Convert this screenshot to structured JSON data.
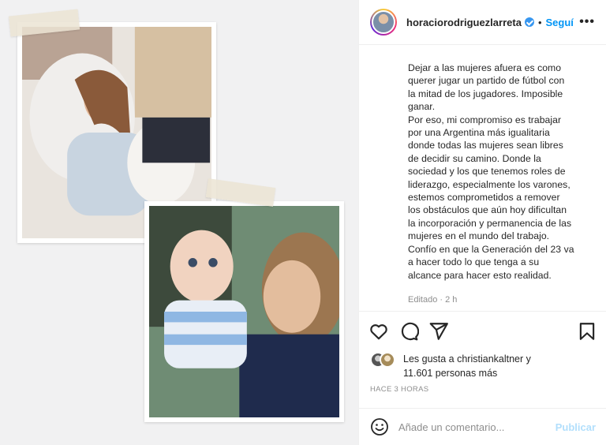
{
  "post": {
    "username": "horaciorodriguezlarreta",
    "follow_label": "Seguí",
    "more_label": "•••",
    "caption_lines": [
      "Dejar a las mujeres afuera es como",
      "querer jugar un partido de fútbol con",
      "la mitad de los jugadores. Imposible",
      "ganar.",
      "Por eso, mi compromiso es trabajar",
      "por una Argentina más igualitaria",
      "donde todas las mujeres sean libres",
      "de decidir su camino. Donde la",
      "sociedad y los que tenemos roles de",
      "liderazgo, especialmente los varones,",
      "estemos comprometidos a remover",
      "los obstáculos que aún hoy dificultan",
      "la incorporación y permanencia de las",
      "mujeres en el mundo del trabajo.",
      "Confío en que la Generación del 23 va",
      "a hacer todo lo que tenga a su",
      "alcance para hacer esto realidad."
    ],
    "edited_label": "Editado · 2 h",
    "likes_line1": "Les gusta a christiankaltner y",
    "likes_line2": "11.601 personas más",
    "timestamp": "HACE 3 HORAS",
    "comment_placeholder": "Añade un comentario...",
    "publish_label": "Publicar"
  },
  "icons": {
    "like": "heart-icon",
    "comment": "comment-icon",
    "share": "paper-plane-icon",
    "save": "bookmark-icon",
    "emoji": "smiley-icon",
    "verified": "verified-badge-icon"
  },
  "colors": {
    "accent": "#0095f6",
    "publish_disabled": "#b2dffc",
    "verified": "#3897f0",
    "muted_text": "#8e8e8e"
  }
}
